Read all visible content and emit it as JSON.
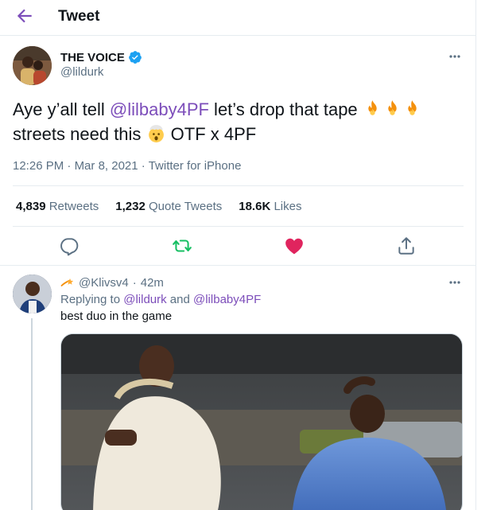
{
  "header": {
    "title": "Tweet"
  },
  "tweet": {
    "author_name": "THE VOICE",
    "author_handle": "@lildurk",
    "text_part1": "Aye y’all tell ",
    "mention": "@lilbaby4PF",
    "text_part2": " let’s drop that tape ",
    "text_line2_start": "streets need this ",
    "text_line2_end": " OTF x 4PF",
    "time": "12:26 PM",
    "date": "Mar 8, 2021",
    "source": "Twitter for iPhone",
    "sep": "·",
    "stats": {
      "retweets_count": "4,839",
      "retweets_label": "Retweets",
      "quotes_count": "1,232",
      "quotes_label": "Quote Tweets",
      "likes_count": "18.6K",
      "likes_label": "Likes"
    }
  },
  "reply": {
    "handle": "@Klivsv4",
    "time": "42m",
    "replying_prefix": "Replying to ",
    "replying_user1": "@lildurk",
    "replying_and": " and ",
    "replying_user2": "@lilbaby4PF",
    "text": "best duo in the game"
  },
  "colors": {
    "accent": "#7c4dba",
    "like": "#e0245e",
    "retweet": "#17bf63",
    "muted": "#5b7083",
    "verified": "#1da1f2"
  },
  "icons": [
    "back-arrow-icon",
    "verified-badge-icon",
    "more-icon",
    "fire-emoji-icon",
    "exploding-head-emoji-icon",
    "reply-icon",
    "retweet-icon",
    "like-heart-icon",
    "share-icon",
    "shooting-star-emoji-icon"
  ]
}
